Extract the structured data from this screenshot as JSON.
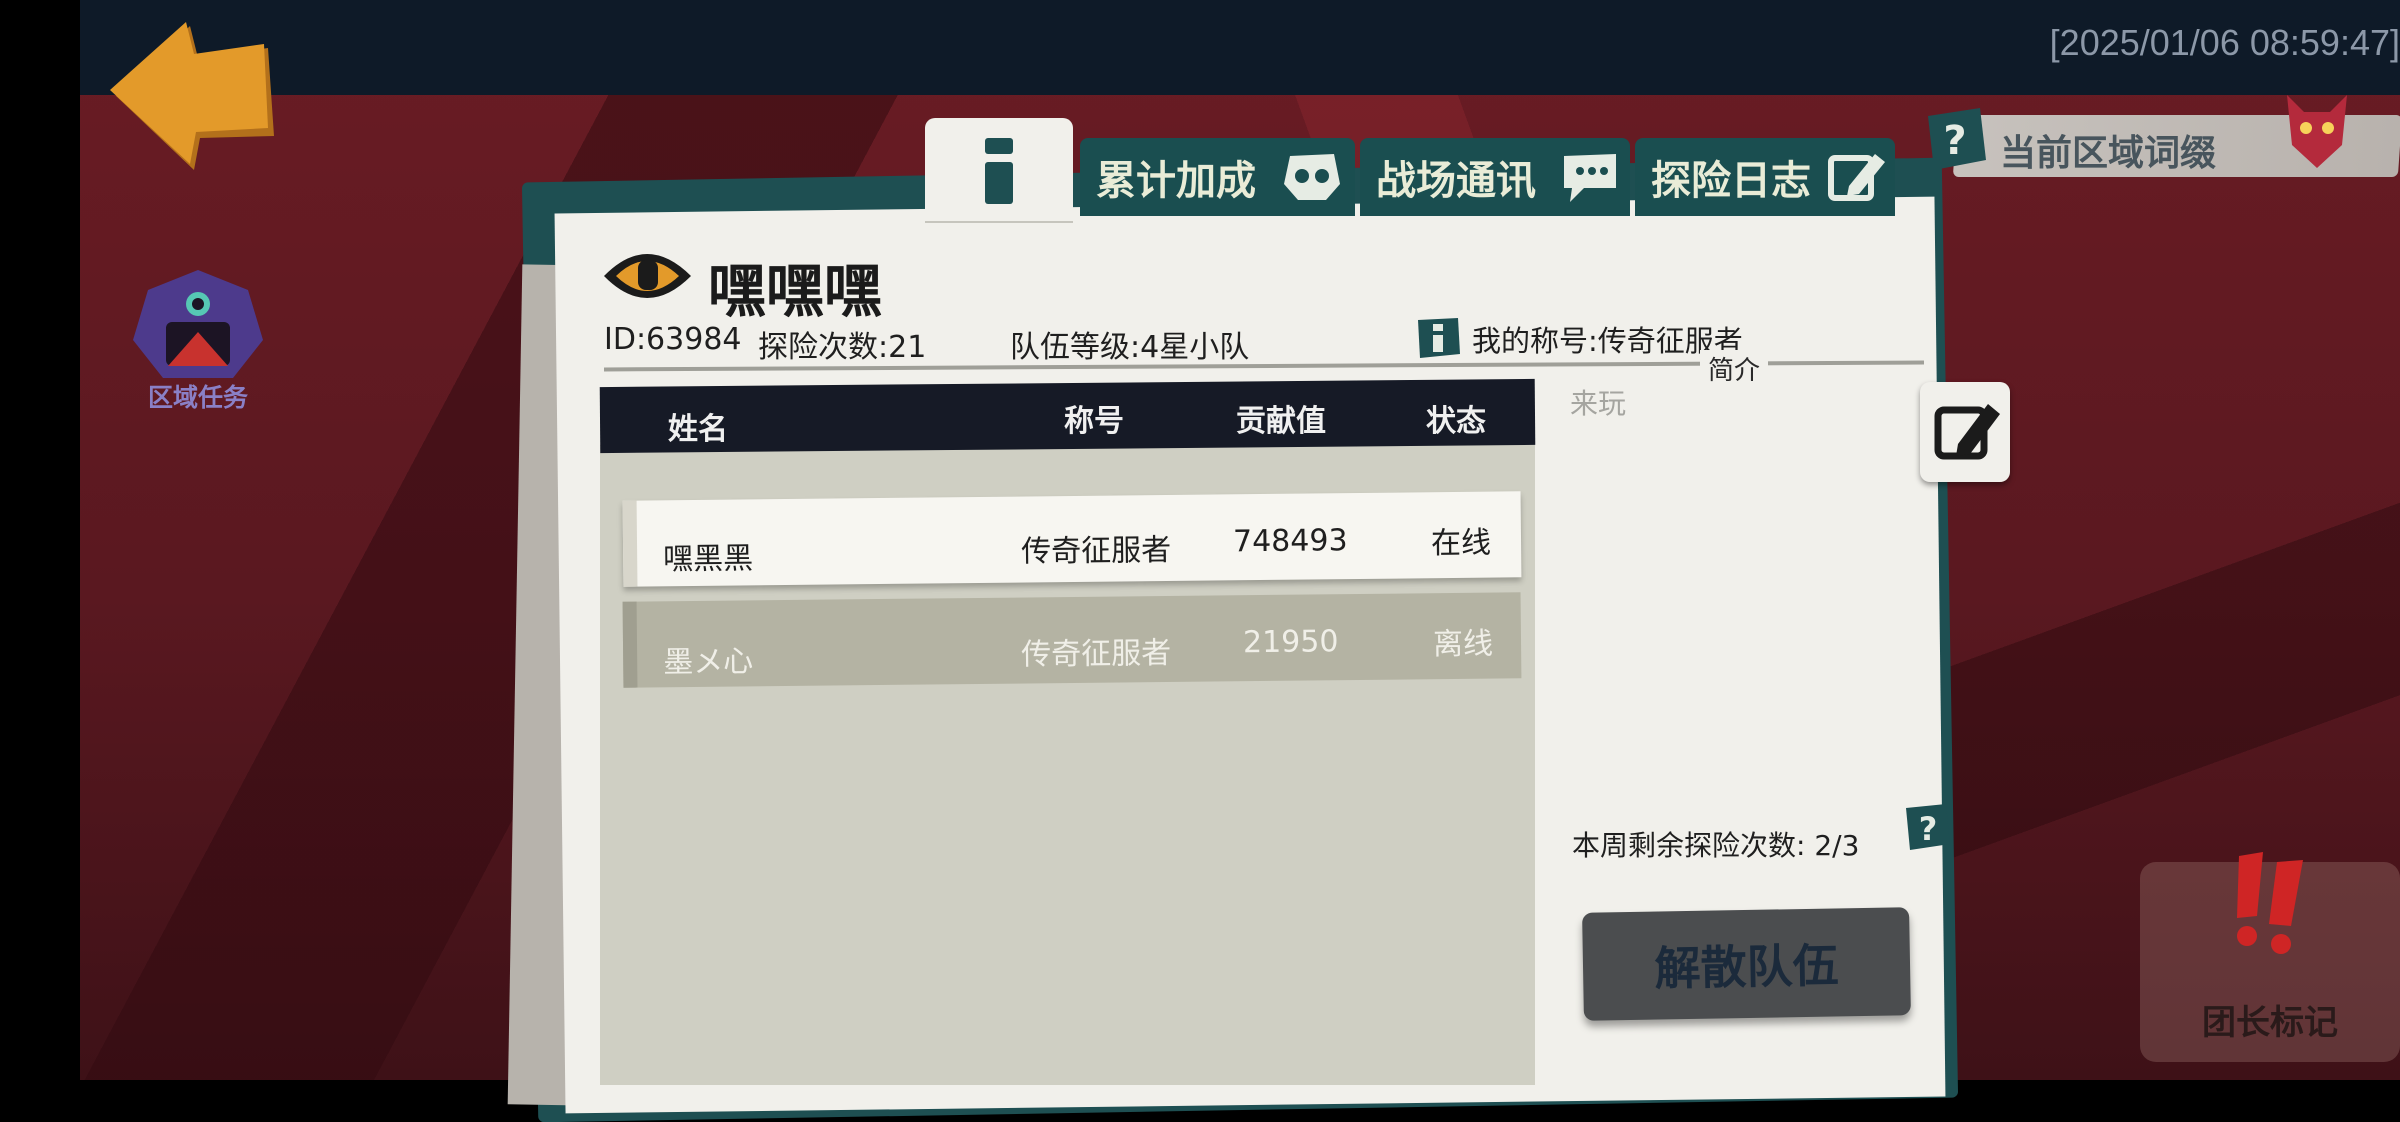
{
  "top_bar": {
    "timestamp": "[2025/01/06 08:59:47]"
  },
  "left": {
    "back_icon": "back-arrow-icon",
    "region_task_label": "区域任务"
  },
  "right": {
    "affix_label": "当前区域词缀",
    "captain_mark_label": "团长标记",
    "weekly_remaining": "本周剩余探险次数:  2/3",
    "disband_button": "解散队伍"
  },
  "tabs": [
    {
      "label": "累计加成",
      "icon": "skull-icon"
    },
    {
      "label": "战场通讯",
      "icon": "chat-icon"
    },
    {
      "label": "探险日志",
      "icon": "edit-icon"
    }
  ],
  "team": {
    "name": "嘿嘿嘿",
    "id_text": "ID:63984",
    "expeditions_text": "探险次数:21",
    "level_text": "队伍等级:4星小队",
    "my_title_text": "我的称号:传奇征服者",
    "intro_label": "简介",
    "intro_text": "来玩"
  },
  "table": {
    "headers": [
      "姓名",
      "称号",
      "贡献值",
      "状态"
    ],
    "rows": [
      {
        "name": "嘿黑黑",
        "title": "传奇征服者",
        "contribution": "748493",
        "status": "在线"
      },
      {
        "name": "墨メ心",
        "title": "传奇征服者",
        "contribution": "21950",
        "status": "离线"
      }
    ]
  },
  "colors": {
    "teal": "#1a4e50",
    "paper": "#f1f0eb",
    "header_dark": "#161a26",
    "accent_orange": "#e39a2a"
  }
}
